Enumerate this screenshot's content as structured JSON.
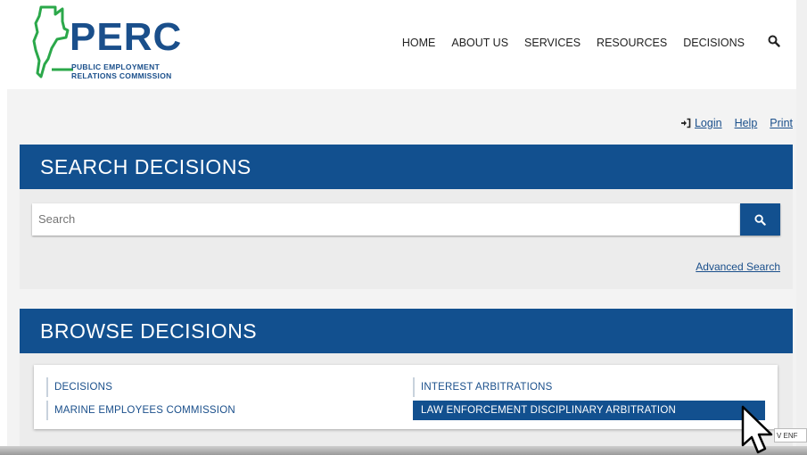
{
  "brand": {
    "name": "PERC",
    "sub_line1": "PUBLIC EMPLOYMENT",
    "sub_line2": "RELATIONS COMMISSION",
    "color": "#1a4f8b",
    "map_color": "#2ba84a"
  },
  "nav": {
    "items": [
      {
        "label": "HOME"
      },
      {
        "label": "ABOUT US"
      },
      {
        "label": "SERVICES"
      },
      {
        "label": "RESOURCES"
      },
      {
        "label": "DECISIONS"
      }
    ],
    "search_icon": "search-icon"
  },
  "utility": {
    "login_icon": "login-icon",
    "login": "Login",
    "help": "Help",
    "print": "Print"
  },
  "search_panel": {
    "title": "SEARCH DECISIONS",
    "placeholder": "Search",
    "button_icon": "search-icon",
    "advanced": "Advanced Search"
  },
  "browse_panel": {
    "title": "BROWSE DECISIONS",
    "links": [
      {
        "label": "DECISIONS"
      },
      {
        "label": "MARINE EMPLOYEES COMMISSION"
      },
      {
        "label": "INTEREST ARBITRATIONS"
      },
      {
        "label": "LAW ENFORCEMENT DISCIPLINARY ARBITRATION",
        "active": true
      }
    ]
  },
  "tooltip": "V ENF",
  "colors": {
    "primary": "#12508f",
    "panel_bg": "#ececec"
  }
}
